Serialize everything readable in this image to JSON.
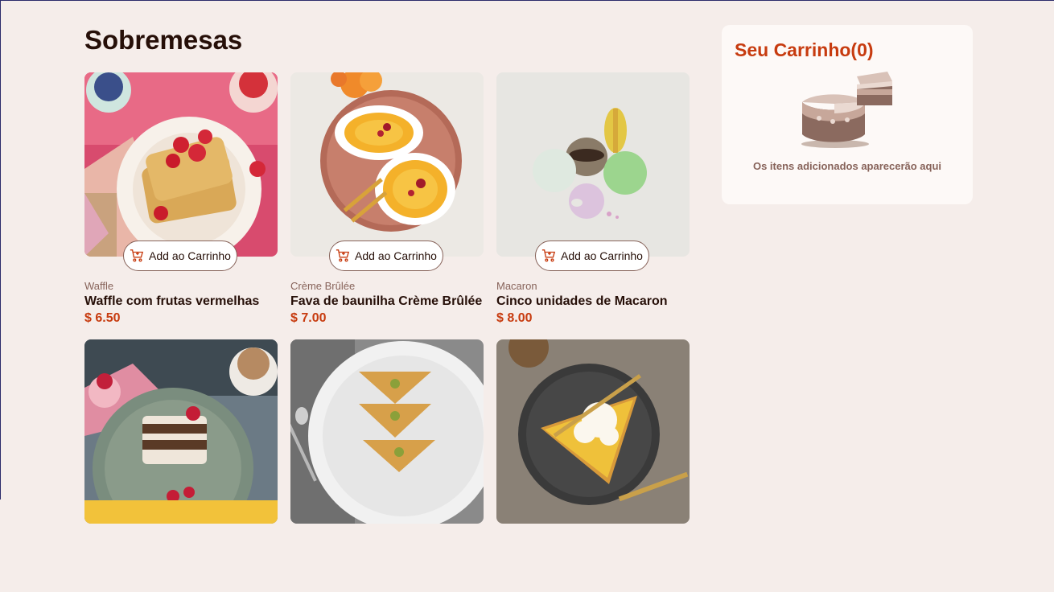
{
  "page": {
    "title": "Sobremesas"
  },
  "products": [
    {
      "category": "Waffle",
      "name": "Waffle com frutas vermelhas",
      "price": "$ 6.50",
      "button": "Add ao Carrinho"
    },
    {
      "category": "Crème Brûlée",
      "name": "Fava de baunilha Crème Brûlée",
      "price": "$ 7.00",
      "button": "Add ao Carrinho"
    },
    {
      "category": "Macaron",
      "name": "Cinco unidades de Macaron",
      "price": "$ 8.00",
      "button": "Add ao Carrinho"
    }
  ],
  "cart": {
    "title": "Seu Carrinho(0)",
    "empty_text": "Os itens adicionados aparecerão aqui"
  },
  "icons": {
    "cart": "add-to-cart-icon",
    "empty": "cake-illustration-icon"
  },
  "colors": {
    "accent": "#c73b0f",
    "background": "#f5edea",
    "text": "#260f08",
    "muted": "#87635a"
  }
}
